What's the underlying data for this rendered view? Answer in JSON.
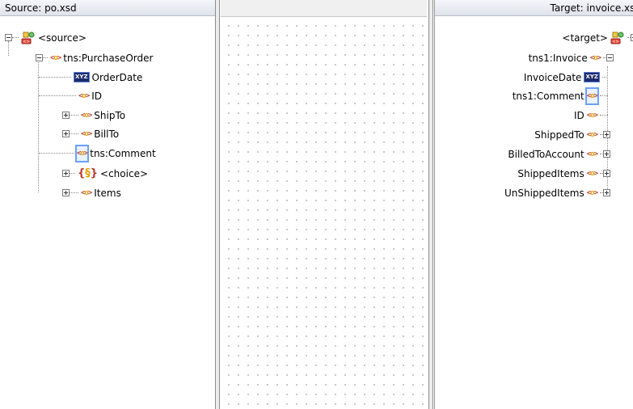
{
  "source": {
    "header": "Source: po.xsd",
    "root_label": "<source>",
    "purchase_order": "tns:PurchaseOrder",
    "order_date": "OrderDate",
    "id": "ID",
    "ship_to": "ShipTo",
    "bill_to": "BillTo",
    "comment": "tns:Comment",
    "choice": "<choice>",
    "items": "Items"
  },
  "target": {
    "header": "Target: invoice.xsd",
    "root_label": "<target>",
    "invoice": "tns1:Invoice",
    "invoice_date": "InvoiceDate",
    "comment": "tns1:Comment",
    "id": "ID",
    "shipped_to": "ShippedTo",
    "billed_to_account": "BilledToAccount",
    "shipped_items": "ShippedItems",
    "unshipped_items": "UnShippedItems"
  },
  "icons": {
    "element": "element-icon",
    "attribute": "attribute-icon",
    "schema": "schema-icon",
    "choice": "choice-icon"
  }
}
